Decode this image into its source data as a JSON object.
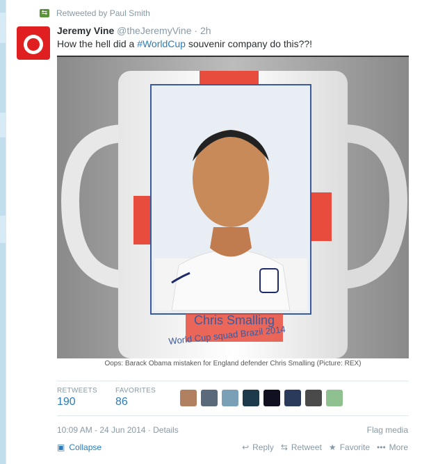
{
  "retweet": {
    "text": "Retweeted by Paul Smith",
    "icon": "retweet-icon"
  },
  "author": {
    "name": "Jeremy Vine",
    "handle": "@theJeremyVine",
    "dot": "·",
    "time": "2h"
  },
  "tweet": {
    "before": "How the hell did a ",
    "hashtag": "#WorldCup",
    "after": " souvenir company do this??!"
  },
  "photo": {
    "mug_name": "Chris Smalling",
    "mug_line2": "World Cup squad Brazil 2014"
  },
  "caption": "Oops: Barack Obama mistaken for England defender Chris Smalling (Picture: REX)",
  "stats": {
    "retweets_label": "RETWEETS",
    "retweets_value": "190",
    "favorites_label": "FAVORITES",
    "favorites_value": "86"
  },
  "meta": {
    "timestamp": "10:09 AM - 24 Jun 2014",
    "sep": "·",
    "details": "Details",
    "flag": "Flag media"
  },
  "footer": {
    "collapse": "Collapse",
    "reply": "Reply",
    "retweet": "Retweet",
    "favorite": "Favorite",
    "more": "More"
  },
  "colors": {
    "link": "#2b7bb9",
    "muted": "#8899a6",
    "retweet_green": "#5c913b",
    "background": "#c0deed"
  }
}
